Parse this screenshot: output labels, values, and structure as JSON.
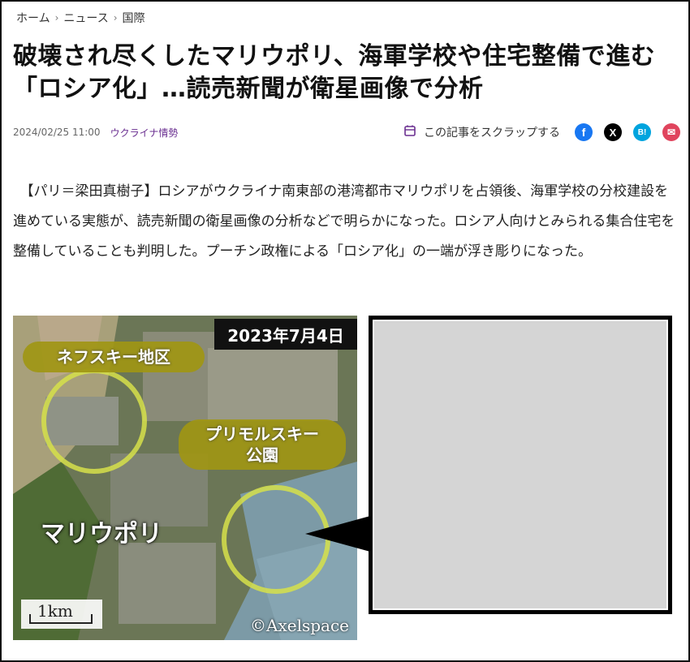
{
  "breadcrumb": {
    "home": "ホーム",
    "news": "ニュース",
    "section": "国際",
    "separator": "›"
  },
  "article": {
    "title": "破壊され尽くしたマリウポリ、海軍学校や住宅整備で進む「ロシア化」…読売新聞が衛星画像で分析",
    "date": "2024/02/25 11:00",
    "category": "ウクライナ情勢",
    "scrap_label": "この記事をスクラップする",
    "body": "　【パリ＝梁田真樹子】ロシアがウクライナ南東部の港湾都市マリウポリを占領後、海軍学校の分校建設を進めている実態が、読売新聞の衛星画像の分析などで明らかになった。ロシア人向けとみられる集合住宅を整備していることも判明した。プーチン政権による「ロシア化」の一端が浮き彫りになった。"
  },
  "share": {
    "facebook": "f",
    "x": "X",
    "hatena": "B!",
    "mail": "✉"
  },
  "figure": {
    "date_label": "2023年7月4日",
    "label_nevsky": "ネフスキー地区",
    "label_primorsky_1": "プリモルスキー",
    "label_primorsky_2": "公園",
    "city_label": "マリウポリ",
    "scale_label": "1km",
    "credit": "©Axelspace"
  },
  "colors": {
    "accent_purple": "#6a2f90",
    "facebook": "#1877f2",
    "hatena": "#00a4de",
    "mail": "#e0445d",
    "highlight_circle": "#d6e04a"
  }
}
